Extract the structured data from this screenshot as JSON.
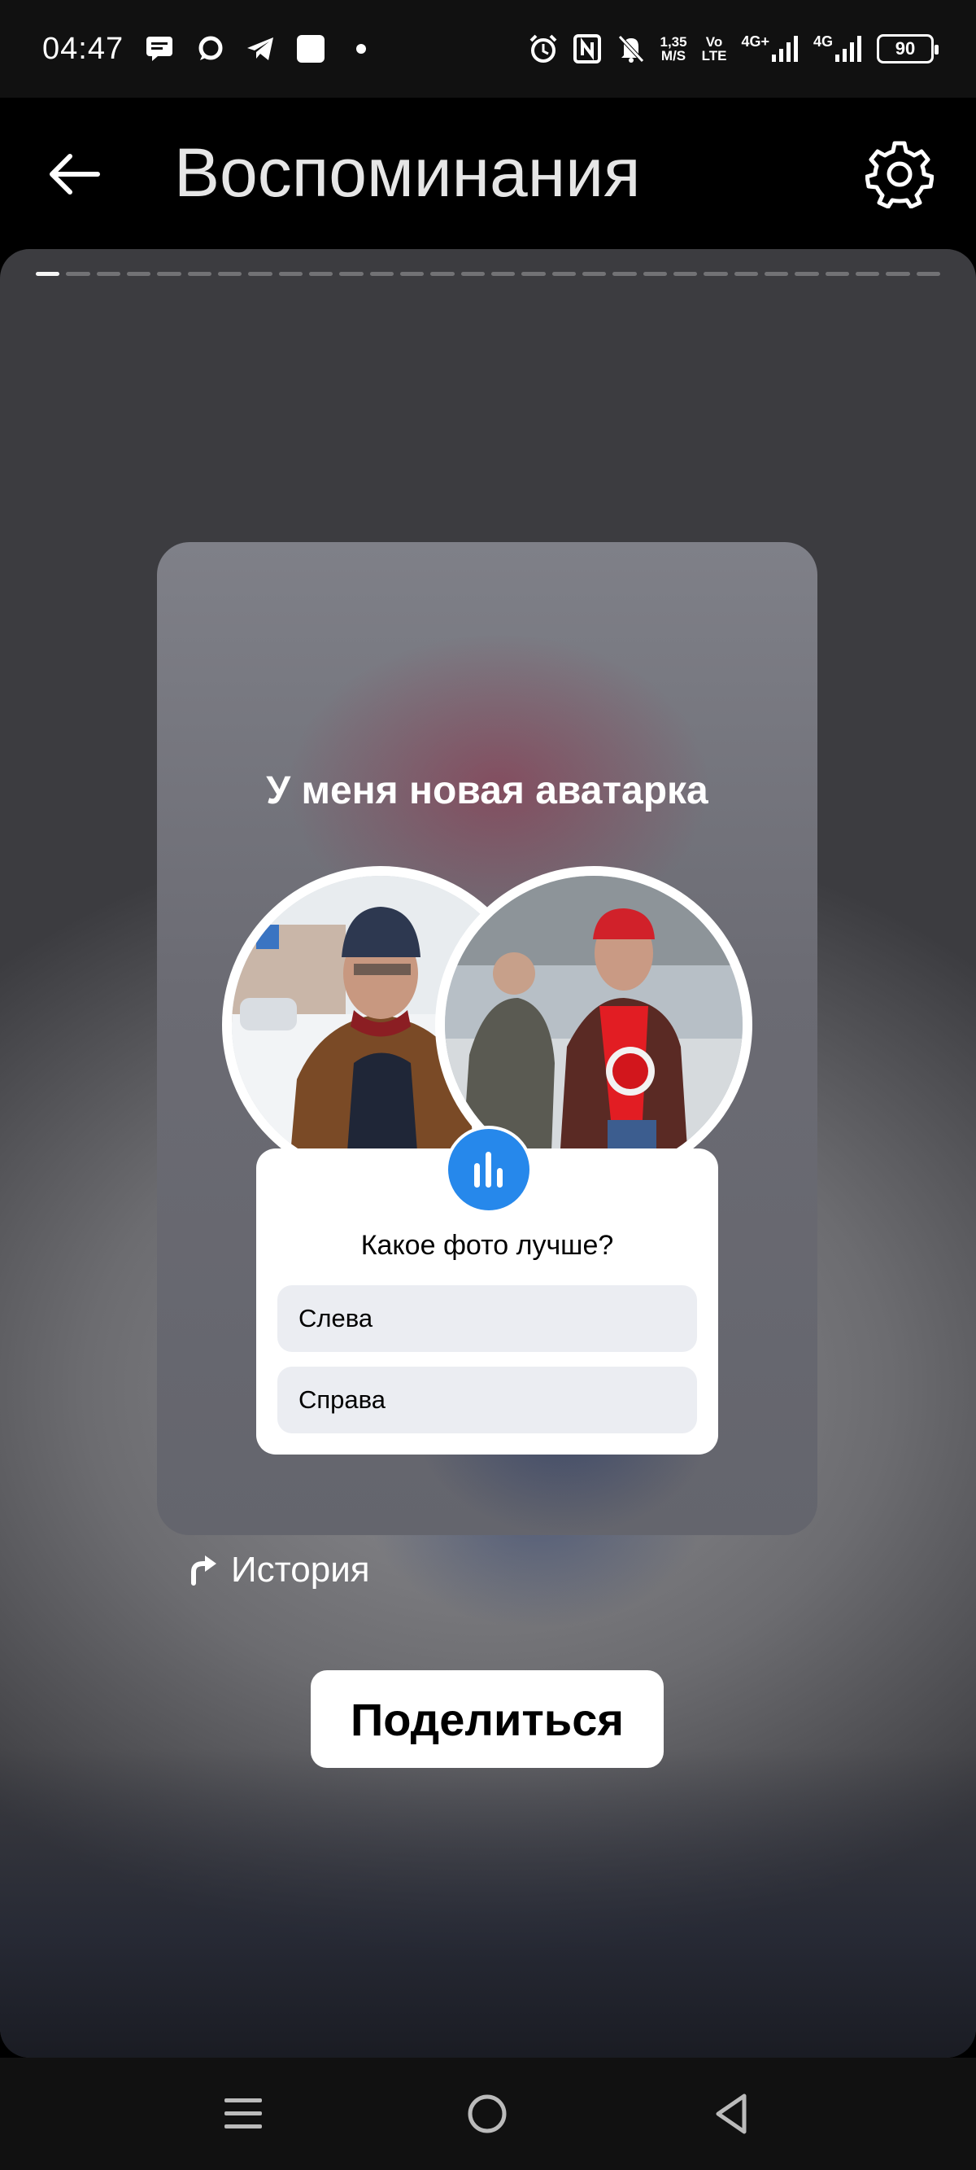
{
  "status_bar": {
    "time": "04:47",
    "net_speed_top": "1,35",
    "net_speed_bottom": "M/S",
    "volte_top": "Vo",
    "volte_bottom": "LTE",
    "sim1_type": "4G+",
    "sim2_type": "4G",
    "battery": "90"
  },
  "header": {
    "title": "Воспоминания"
  },
  "story": {
    "progress_total": 30,
    "progress_current": 1,
    "card_caption": "У меня новая аватарка",
    "poll": {
      "question": "Какое фото лучше?",
      "options": [
        "Слева",
        "Справа"
      ]
    },
    "history_label": "История",
    "share_label": "Поделиться"
  },
  "colors": {
    "accent": "#2688eb",
    "status_bar_bg": "#111111",
    "header_bg": "#000000"
  }
}
